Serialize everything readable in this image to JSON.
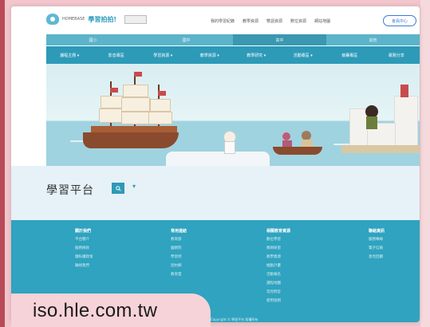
{
  "header": {
    "logo_small": "HOMEBASE",
    "logo_name": "學習拍拍!",
    "top_links": [
      "我的學習紀錄",
      "教學資源",
      "雙語資源",
      "數位資源",
      "網站地圖"
    ],
    "member_button": "會員中心"
  },
  "nav_top": [
    "國小",
    "國中",
    "高中",
    "其他"
  ],
  "nav_main": [
    "課程主題 ▾",
    "影音專區",
    "學習資源 ▾",
    "教學資源 ▾",
    "教學研究 ▾",
    "活動專區 ▾",
    "競賽專區",
    "專題分享"
  ],
  "platform": {
    "title": "學習平台",
    "button_icon": "search-icon",
    "caret": "▾"
  },
  "footer": {
    "columns": [
      {
        "heading": "關於我們",
        "items": [
          "平台簡介",
          "服務條款",
          "隱私權政策",
          "聯絡我們"
        ]
      },
      {
        "heading": "常用連結",
        "items": [
          "教育部",
          "國教院",
          "學習吧",
          "因材網",
          "教育雲"
        ]
      },
      {
        "heading": "相關教育資源",
        "items": [
          "數位學習",
          "教師研習",
          "教學資源",
          "推動計畫",
          "活動報名",
          "課程地圖",
          "常見問答",
          "使用說明"
        ]
      },
      {
        "heading": "聯絡資訊",
        "items": [
          "服務專線",
          "電子信箱",
          "意見回饋"
        ]
      }
    ],
    "copyright": "Copyright © 學習平台 版權所有"
  },
  "overlay": {
    "url": "iso.hle.com.tw"
  },
  "colors": {
    "teal_main": "#2d9ab8",
    "teal_light": "#5bb4c9",
    "footer": "#2fa3bf",
    "pink_bg": "#f2c6cc"
  }
}
